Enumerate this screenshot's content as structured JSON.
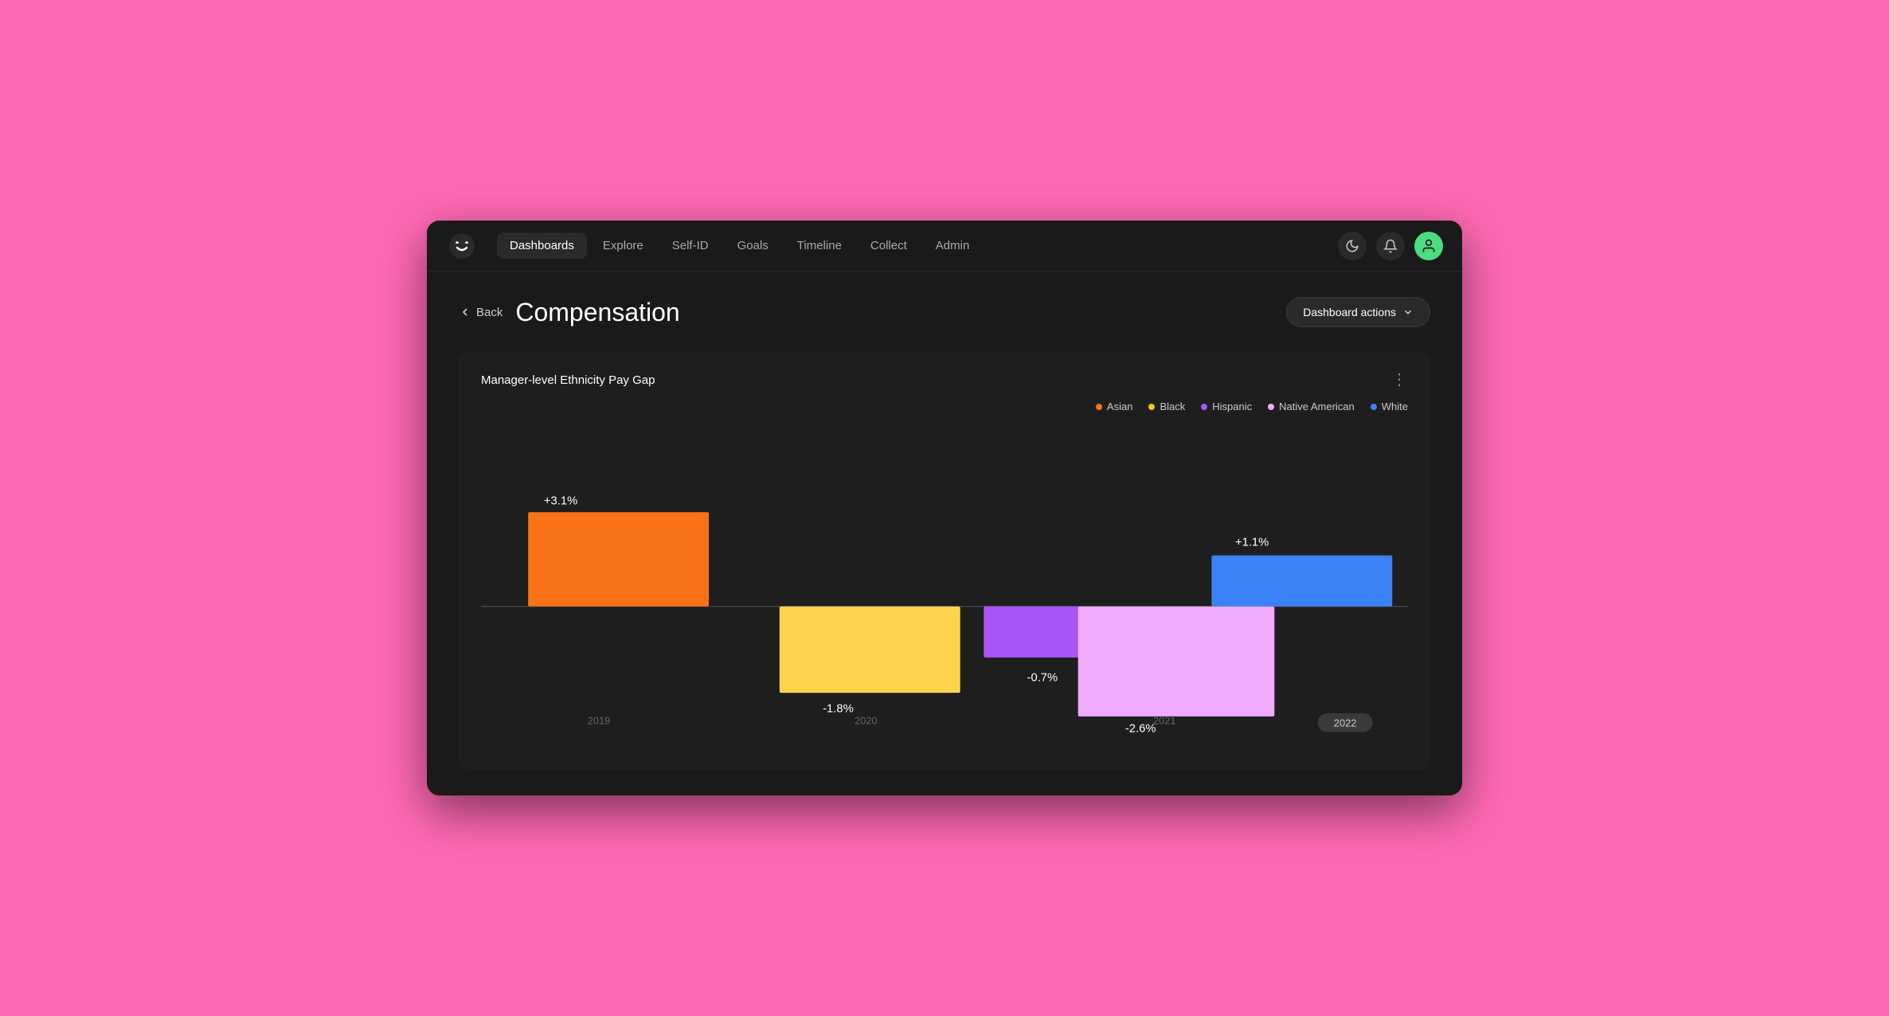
{
  "nav": {
    "logo_alt": "Logo",
    "items": [
      {
        "label": "Dashboards",
        "active": true
      },
      {
        "label": "Explore",
        "active": false
      },
      {
        "label": "Self-ID",
        "active": false
      },
      {
        "label": "Goals",
        "active": false
      },
      {
        "label": "Timeline",
        "active": false
      },
      {
        "label": "Collect",
        "active": false
      },
      {
        "label": "Admin",
        "active": false
      }
    ],
    "dark_mode_icon": "🌙",
    "bell_icon": "🔔"
  },
  "page": {
    "back_label": "Back",
    "title": "Compensation",
    "dashboard_actions_label": "Dashboard actions"
  },
  "chart": {
    "title": "Manager-level Ethnicity Pay Gap",
    "more_icon": "⋮",
    "legend": [
      {
        "label": "Asian",
        "color": "#f97316"
      },
      {
        "label": "Black",
        "color": "#fbbf24"
      },
      {
        "label": "Hispanic",
        "color": "#a855f7"
      },
      {
        "label": "Native American",
        "color": "#f0abfc"
      },
      {
        "label": "White",
        "color": "#3b82f6"
      }
    ],
    "bars": [
      {
        "label": "Asian",
        "value": "+3.1%",
        "color": "#f97316",
        "year": "2019"
      },
      {
        "label": "Black",
        "value": "-1.8%",
        "color": "#fcd34d",
        "year": "2020"
      },
      {
        "label": "Hispanic",
        "value": "-0.7%",
        "color": "#a855f7",
        "year": "2021a"
      },
      {
        "label": "Native American",
        "value": "-2.6%",
        "color": "#f0abfc",
        "year": "2021b"
      },
      {
        "label": "White",
        "value": "+1.1%",
        "color": "#3b82f6",
        "year": "2022"
      }
    ],
    "x_labels": [
      "2019",
      "2020",
      "2021",
      "2022"
    ]
  }
}
